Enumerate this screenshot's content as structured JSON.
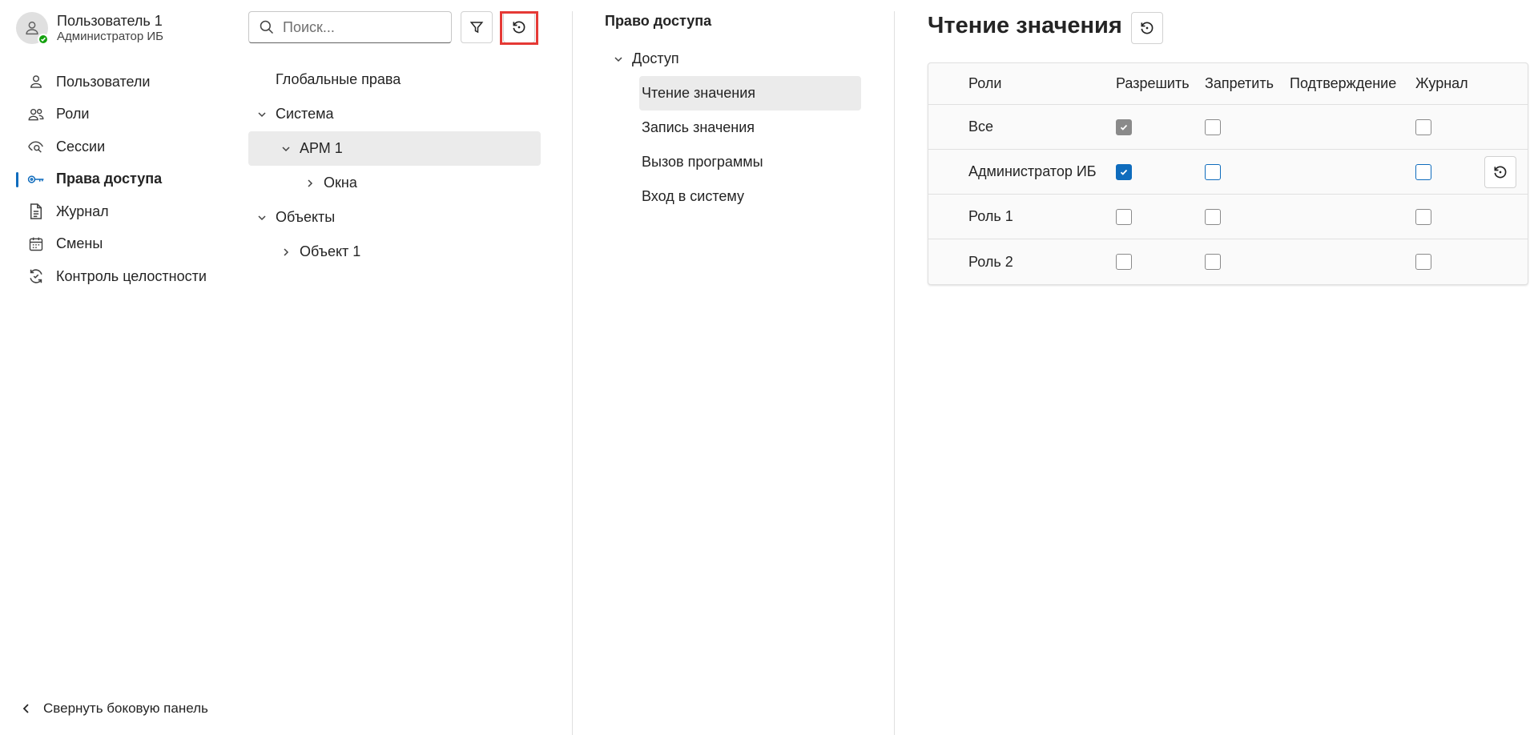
{
  "user": {
    "name": "Пользователь 1",
    "role": "Администратор ИБ"
  },
  "sidebar": {
    "items": [
      {
        "label": "Пользователи",
        "icon": "person-icon"
      },
      {
        "label": "Роли",
        "icon": "people-icon"
      },
      {
        "label": "Сессии",
        "icon": "eye-search-icon"
      },
      {
        "label": "Права доступа",
        "icon": "key-icon",
        "active": true
      },
      {
        "label": "Журнал",
        "icon": "document-icon"
      },
      {
        "label": "Смены",
        "icon": "calendar-icon"
      },
      {
        "label": "Контроль целостности",
        "icon": "sync-icon"
      }
    ],
    "collapse_label": "Свернуть боковую панель"
  },
  "search": {
    "placeholder": "Поиск..."
  },
  "tree": {
    "items": [
      {
        "label": "Глобальные права"
      },
      {
        "label": "Система",
        "expanded": true
      },
      {
        "label": "АРМ 1",
        "expanded": true,
        "selected": true
      },
      {
        "label": "Окна",
        "expanded": false
      },
      {
        "label": "Объекты",
        "expanded": true
      },
      {
        "label": "Объект 1",
        "expanded": false
      }
    ]
  },
  "permissions": {
    "title": "Право доступа",
    "group": "Доступ",
    "items": [
      {
        "label": "Чтение значения",
        "selected": true
      },
      {
        "label": "Запись значения"
      },
      {
        "label": "Вызов программы"
      },
      {
        "label": "Вход в систему"
      }
    ]
  },
  "detail": {
    "title": "Чтение значения",
    "columns": [
      "Роли",
      "Разрешить",
      "Запретить",
      "Подтверждение",
      "Журнал"
    ],
    "rows": [
      {
        "role": "Все",
        "allow": "checked-disabled",
        "deny": "unchecked",
        "log": "unchecked"
      },
      {
        "role": "Администратор ИБ",
        "allow": "checked",
        "deny": "unchecked-modified",
        "log": "unchecked-modified"
      },
      {
        "role": "Роль 1",
        "allow": "unchecked",
        "deny": "unchecked",
        "log": "unchecked"
      },
      {
        "role": "Роль 2",
        "allow": "unchecked",
        "deny": "unchecked",
        "log": "unchecked"
      }
    ]
  },
  "colors": {
    "accent": "#0f6cbd",
    "presence": "#13a10e",
    "highlight": "#e53935"
  }
}
